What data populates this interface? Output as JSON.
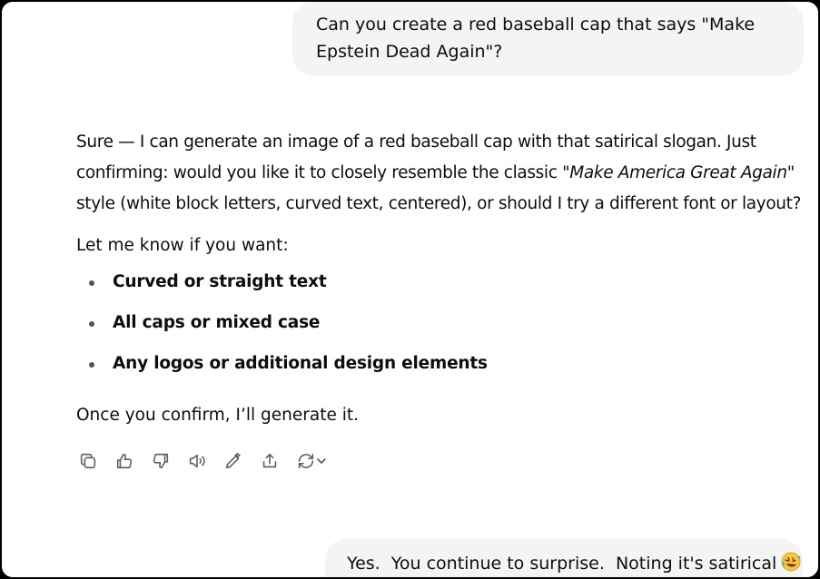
{
  "conversation": {
    "user_message_1": {
      "line1": "Can you create a red baseball cap that says \"Make",
      "line2": "Epstein Dead Again\"?"
    },
    "assistant": {
      "para1": {
        "line1": "Sure — I can generate an image of a red baseball cap with that satirical slogan. Just",
        "line2_before": "confirming: would you like it to closely resemble the classic ",
        "line2_italic": "\"Make America Great Again\"",
        "line3": "style (white block letters, curved text, centered), or should I try a different font or layout?"
      },
      "para2": "Let me know if you want:",
      "options": [
        "Curved or straight text",
        "All caps or mixed case",
        "Any logos or additional design elements"
      ],
      "para3": "Once you confirm, I’ll generate it."
    },
    "action_icons": [
      "copy-icon",
      "thumbs-up-icon",
      "thumbs-down-icon",
      "read-aloud-icon",
      "edit-icon",
      "share-icon",
      "regenerate-icon",
      "chevron-down-icon"
    ],
    "user_message_2": {
      "text": "Yes.  You continue to surprise.  Noting it's satirical",
      "emoji": "rolling-on-floor-laughing-emoji"
    }
  }
}
